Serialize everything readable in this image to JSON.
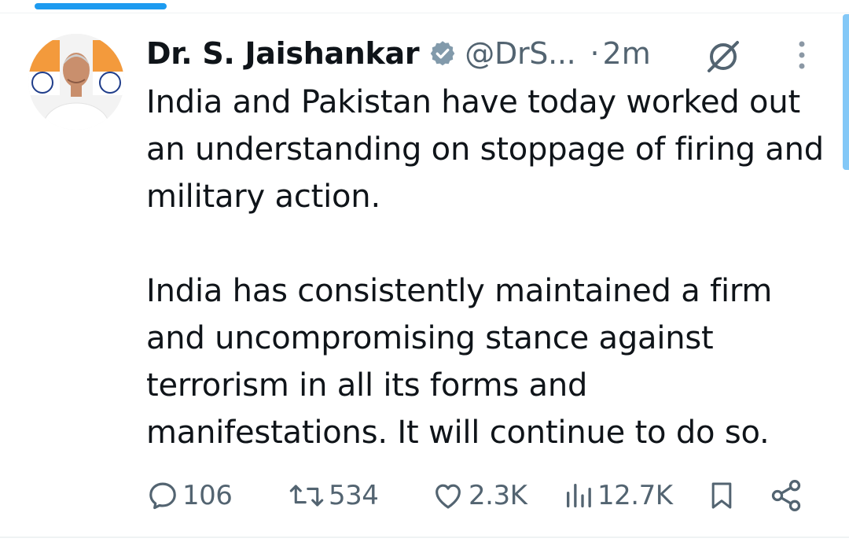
{
  "tweet": {
    "author": {
      "name": "Dr. S. Jaishankar",
      "handle": "@DrS...",
      "verified_icon": "verified-badge-icon"
    },
    "time_separator": "·",
    "time": "2m",
    "paragraphs": [
      "India and Pakistan have today worked out an understanding on stoppage of firing and military action.",
      "India has consistently maintained a firm and uncompromising stance against terrorism in all its forms and manifestations. It will continue to do so."
    ],
    "stats": {
      "replies": "106",
      "reposts": "534",
      "likes": "2.3K",
      "views": "12.7K"
    }
  },
  "colors": {
    "accent": "#1d9bf0",
    "text_primary": "#0f1419",
    "text_secondary": "#536471"
  }
}
